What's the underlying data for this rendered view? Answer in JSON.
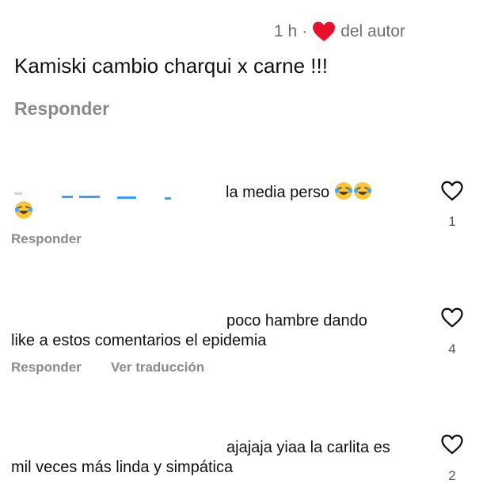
{
  "parent_comment": {
    "time": "1 h",
    "separator": "·",
    "liked_by_author_label": "del autor",
    "text": "Kamiski cambio charqui x carne !!!",
    "reply_label": "Responder"
  },
  "replies": [
    {
      "text_line1": "la media perso",
      "reply_label": "Responder",
      "like_count": "1",
      "emoji": "face-with-tears-of-joy"
    },
    {
      "text_line1": "poco hambre dando",
      "text_line2": "like a estos comentarios el epidemia",
      "reply_label": "Responder",
      "translate_label": "Ver traducción",
      "like_count": "4"
    },
    {
      "text_line1": "ajajaja yiaa la carlita es",
      "text_line2": "mil veces más linda y simpática",
      "like_count": "2"
    }
  ],
  "colors": {
    "heart": "#e8102c",
    "muted_text": "#8a8a8a",
    "body_text": "#111111",
    "emoji_face": "#f7c43a",
    "tear": "#3fa9f5",
    "redacted_blue": "#3aa0ff"
  }
}
